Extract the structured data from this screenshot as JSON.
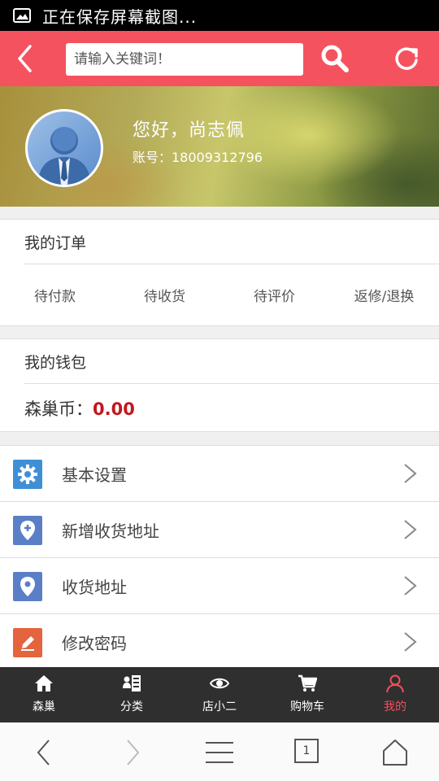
{
  "status_bar": {
    "text": "正在保存屏幕截图..."
  },
  "header": {
    "search_placeholder": "请输入关键词！"
  },
  "profile": {
    "greeting": "您好，尚志佩",
    "account": "账号：18009312796"
  },
  "orders": {
    "title": "我的订单",
    "tabs": [
      {
        "label": "待付款"
      },
      {
        "label": "待收货"
      },
      {
        "label": "待评价"
      },
      {
        "label": "返修/退换"
      }
    ]
  },
  "wallet": {
    "title": "我的钱包",
    "coin_label": "森巢币：",
    "coin_value": "0.00"
  },
  "menu": [
    {
      "label": "基本设置",
      "icon": "gear-icon",
      "color": "#3f8fd6"
    },
    {
      "label": "新增收货地址",
      "icon": "add-location-icon",
      "color": "#5b7fc6"
    },
    {
      "label": "收货地址",
      "icon": "location-icon",
      "color": "#5b7fc6"
    },
    {
      "label": "修改密码",
      "icon": "pencil-icon",
      "color": "#e4643d"
    }
  ],
  "tabbar": [
    {
      "label": "森巢",
      "icon": "home-icon"
    },
    {
      "label": "分类",
      "icon": "category-icon"
    },
    {
      "label": "店小二",
      "icon": "eye-icon"
    },
    {
      "label": "购物车",
      "icon": "cart-icon"
    },
    {
      "label": "我的",
      "icon": "user-icon",
      "active": true
    }
  ],
  "browser_nav": {
    "tab_count": "1"
  },
  "colors": {
    "accent": "#f5525f",
    "coin": "#c3171e",
    "tabbar_bg": "#2f2f2f",
    "tab_active": "#f04f5c"
  }
}
